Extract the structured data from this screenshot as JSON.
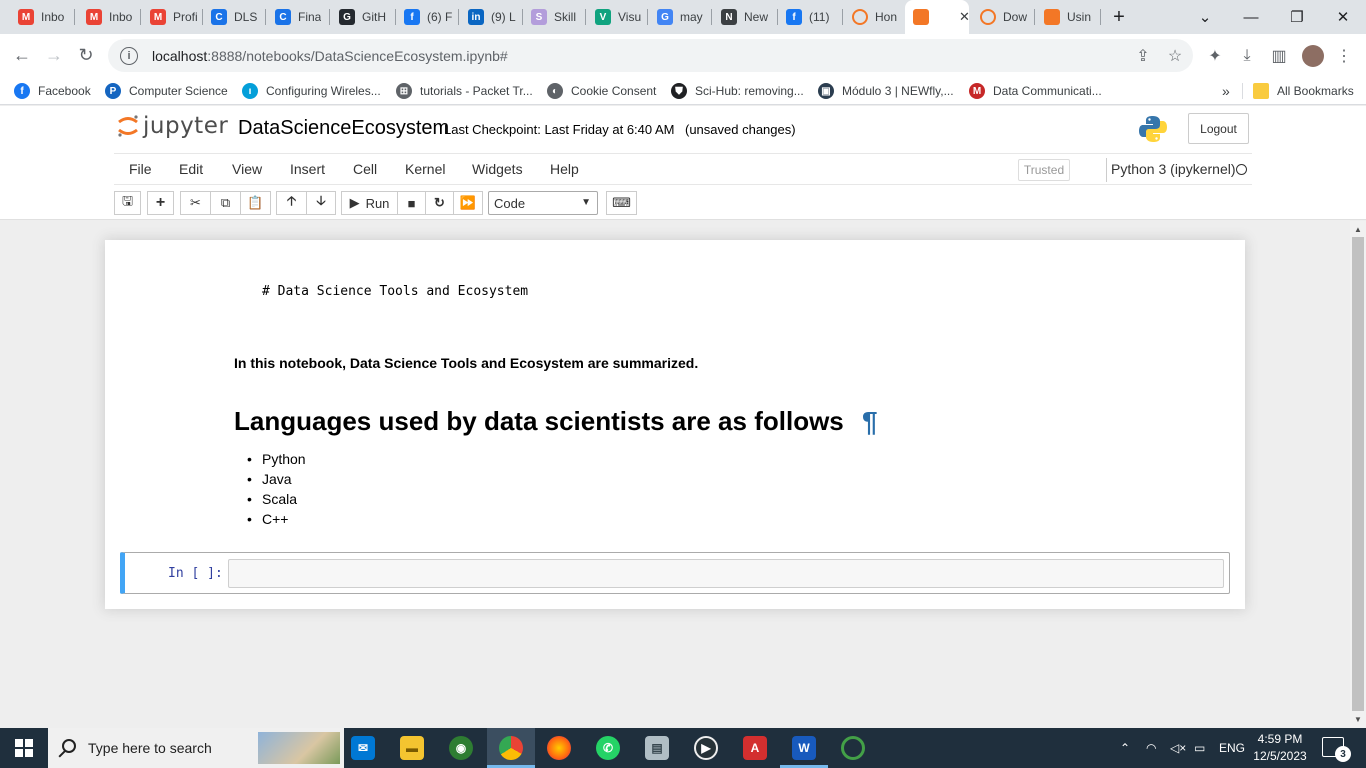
{
  "browser": {
    "tabs": [
      {
        "label": "Inbo",
        "icon": "gmail-icon",
        "color": "#ea4335",
        "glyph": "M"
      },
      {
        "label": "Inbo",
        "icon": "gmail-icon",
        "color": "#ea4335",
        "glyph": "M"
      },
      {
        "label": "Profi",
        "icon": "gmail-icon",
        "color": "#ea4335",
        "glyph": "M"
      },
      {
        "label": "DLS",
        "icon": "c-icon",
        "color": "#1a73e8",
        "glyph": "C"
      },
      {
        "label": "Fina",
        "icon": "c-icon",
        "color": "#1a73e8",
        "glyph": "C"
      },
      {
        "label": "GitH",
        "icon": "github-icon",
        "color": "#24292f",
        "glyph": "G"
      },
      {
        "label": "(6) F",
        "icon": "facebook-icon",
        "color": "#1877f2",
        "glyph": "f"
      },
      {
        "label": "(9) L",
        "icon": "linkedin-icon",
        "color": "#0a66c2",
        "glyph": "in"
      },
      {
        "label": "Skill",
        "icon": "skills-icon",
        "color": "#b39ddb",
        "glyph": "S"
      },
      {
        "label": "Visu",
        "icon": "openai-icon",
        "color": "#10a37f",
        "glyph": "V"
      },
      {
        "label": "may",
        "icon": "google-icon",
        "color": "#4285f4",
        "glyph": "G"
      },
      {
        "label": "New",
        "icon": "github-icon",
        "color": "#3c4043",
        "glyph": "N"
      },
      {
        "label": "(11)",
        "icon": "facebook-icon",
        "color": "#1877f2",
        "glyph": "f"
      },
      {
        "label": "Hon",
        "icon": "jupyter-icon",
        "color": "#f37726",
        "glyph": ""
      },
      {
        "label": "",
        "icon": "notebook-icon",
        "color": "#f37726",
        "glyph": ""
      },
      {
        "label": "Dow",
        "icon": "jupyter-icon",
        "color": "#f37726",
        "glyph": ""
      },
      {
        "label": "Usin",
        "icon": "notebook-icon",
        "color": "#f37726",
        "glyph": ""
      }
    ],
    "url_host": "localhost",
    "url_path": ":8888/notebooks/DataScienceEcosystem.ipynb#",
    "bookmarks": [
      {
        "label": "Facebook",
        "icon": "facebook-icon",
        "color": "#1877f2",
        "glyph": "f"
      },
      {
        "label": "Computer Science",
        "icon": "p-icon",
        "color": "#1565c0",
        "glyph": "P"
      },
      {
        "label": "Configuring Wireles...",
        "icon": "cisco-icon",
        "color": "#049fd9",
        "glyph": "ı"
      },
      {
        "label": "tutorials - Packet Tr...",
        "icon": "network-icon",
        "color": "#5f6368",
        "glyph": "⊞"
      },
      {
        "label": "Cookie Consent",
        "icon": "globe-icon",
        "color": "#5f6368",
        "glyph": "◐"
      },
      {
        "label": "Sci-Hub: removing...",
        "icon": "shield-icon",
        "color": "#202124",
        "glyph": "⛊"
      },
      {
        "label": "Módulo 3 | NEWfly,...",
        "icon": "image-icon",
        "color": "#2c3e50",
        "glyph": "▣"
      },
      {
        "label": "Data Communicati...",
        "icon": "m-icon",
        "color": "#c62828",
        "glyph": "M"
      }
    ],
    "all_bookmarks": "All Bookmarks"
  },
  "jupyter": {
    "logo_text": "jupyter",
    "notebook_name": "DataScienceEcosystem",
    "checkpoint": "Last Checkpoint: Last Friday at 6:40 AM",
    "unsaved": "(unsaved changes)",
    "logout": "Logout",
    "menu": [
      "File",
      "Edit",
      "View",
      "Insert",
      "Cell",
      "Kernel",
      "Widgets",
      "Help"
    ],
    "trusted": "Trusted",
    "kernel": "Python 3 (ipykernel)",
    "run_label": "Run",
    "cell_type": "Code"
  },
  "notebook": {
    "raw_cell": "# Data Science Tools and Ecosystem",
    "intro": "In this notebook, Data Science Tools and Ecosystem are summarized.",
    "heading": "Languages used by data scientists are as follows",
    "pilcrow": "¶",
    "languages": [
      "Python",
      "Java",
      "Scala",
      "C++"
    ],
    "prompt": "In [ ]:"
  },
  "taskbar": {
    "search_placeholder": "Type here to search",
    "language": "ENG",
    "time": "4:59 PM",
    "date": "12/5/2023",
    "notifications": "3"
  }
}
